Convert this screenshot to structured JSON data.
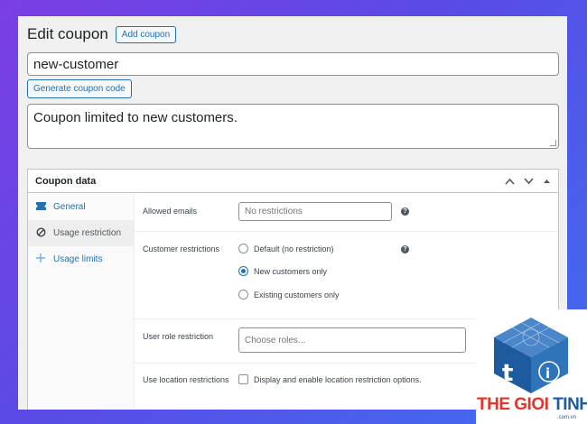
{
  "header": {
    "title": "Edit coupon",
    "add_label": "Add coupon"
  },
  "coupon_code": {
    "value": "new-customer"
  },
  "generate_label": "Generate coupon code",
  "description": {
    "value": "Coupon limited to new customers."
  },
  "coupon_data": {
    "title": "Coupon data",
    "tabs": [
      {
        "label": "General",
        "icon": "ticket-icon",
        "active": false
      },
      {
        "label": "Usage restriction",
        "icon": "prohibit-icon",
        "active": true
      },
      {
        "label": "Usage limits",
        "icon": "plus-icon",
        "active": false
      }
    ],
    "allowed_emails": {
      "label": "Allowed emails",
      "placeholder": "No restrictions"
    },
    "customer_restrictions": {
      "label": "Customer restrictions",
      "options": [
        "Default (no restriction)",
        "New customers only",
        "Existing customers only"
      ],
      "selected": "New customers only"
    },
    "user_role": {
      "label": "User role restriction",
      "placeholder": "Choose roles..."
    },
    "location": {
      "label": "Use location restrictions",
      "checkbox_label": "Display and enable location restriction options.",
      "checked": false
    }
  },
  "watermark": {
    "brand_a": "THE GIOI ",
    "brand_b": "TINHOC",
    "domain": ".com.vn"
  },
  "colors": {
    "accent": "#2271b1",
    "brand_red": "#e0362c",
    "brand_blue": "#1d5b9e"
  }
}
